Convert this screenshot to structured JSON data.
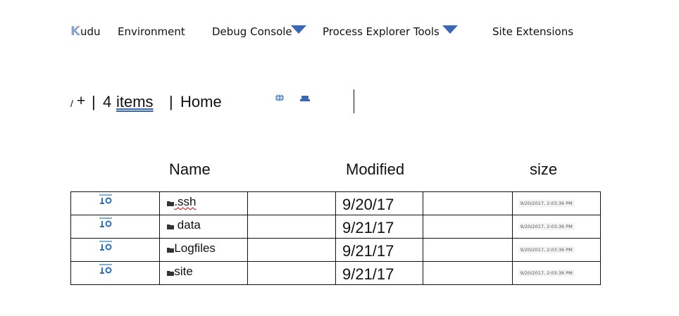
{
  "nav": {
    "brand_k": "K",
    "brand_rest": "udu",
    "items": [
      "Environment",
      "Debug Console",
      "Process Explorer Tools",
      "Site Extensions"
    ],
    "dropdown_icon": "triangle-down",
    "accent": "#3a68b4",
    "brand_accent": "#8aa3c7"
  },
  "path": {
    "root": "/",
    "plus": "+",
    "separator": "|",
    "count": "4",
    "items_label": "items",
    "home": "Home",
    "icons": [
      "globe-icon",
      "drive-icon"
    ]
  },
  "table": {
    "headers": {
      "name": "Name",
      "modified": "Modified",
      "size": "size"
    },
    "rows": [
      {
        "name": ".ssh",
        "modified": "9/20/17",
        "stamp": "9/20/2017, 2:03:36 PM"
      },
      {
        "name": "data",
        "modified": "9/21/17",
        "stamp": "9/20/2017, 2:03:36 PM"
      },
      {
        "name": "Logfiles",
        "modified": "9/21/17",
        "stamp": "9/20/2017, 2:03:36 PM"
      },
      {
        "name": "site",
        "modified": "9/21/17",
        "stamp": "9/20/2017, 2:03:36 PM"
      }
    ],
    "row_icons": [
      "download-icon",
      "folder-icon"
    ]
  }
}
